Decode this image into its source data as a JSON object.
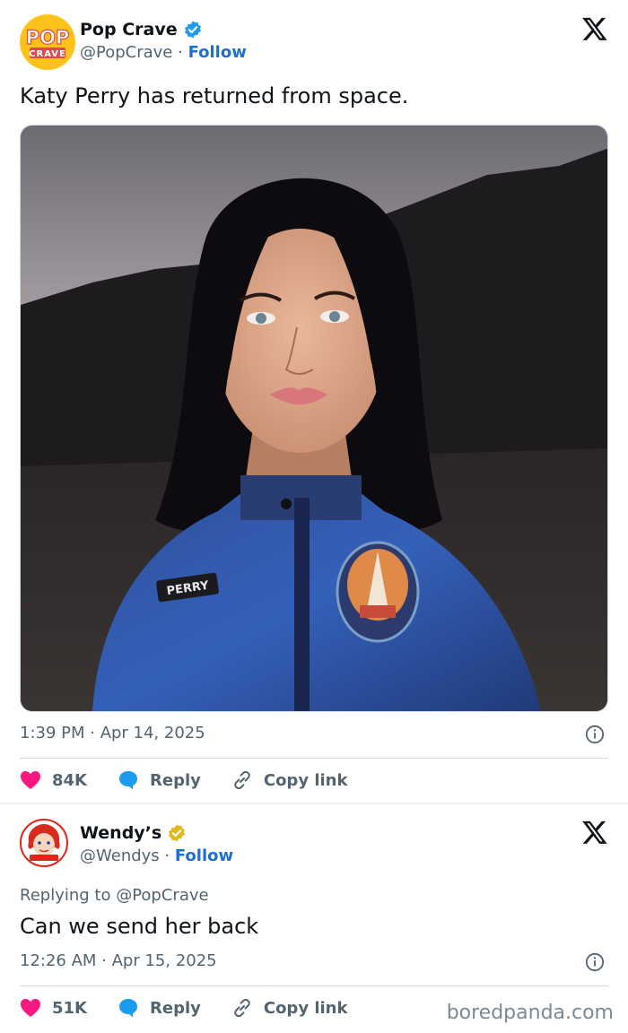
{
  "tweet1": {
    "author_name": "Pop Crave",
    "author_handle": "@PopCrave",
    "follow_label": "Follow",
    "avatar_top": "POP",
    "avatar_bottom": "CRAVE",
    "text": "Katy Perry has returned from space.",
    "photo_badge": "PERRY",
    "timestamp": "1:39 PM · Apr 14, 2025",
    "likes": "84K",
    "reply_label": "Reply",
    "copy_label": "Copy link"
  },
  "tweet2": {
    "author_name": "Wendy’s",
    "author_handle": "@Wendys",
    "follow_label": "Follow",
    "replying_to": "Replying to @PopCrave",
    "text": "Can we send her back",
    "timestamp": "12:26 AM · Apr 15, 2025",
    "likes": "51K",
    "reply_label": "Reply",
    "copy_label": "Copy link"
  },
  "watermark": "boredpanda.com",
  "colors": {
    "like_pink": "#f91880",
    "reply_blue": "#1d9bf0",
    "verified_blue": "#1d9bf0",
    "verified_gold": "#e2b719",
    "follow_blue": "#1d6fd1",
    "pop_crave_yellow": "#ffc21a"
  },
  "icons": [
    "x-logo-icon",
    "verified-badge-icon",
    "heart-icon",
    "reply-bubble-icon",
    "link-icon",
    "info-icon"
  ]
}
